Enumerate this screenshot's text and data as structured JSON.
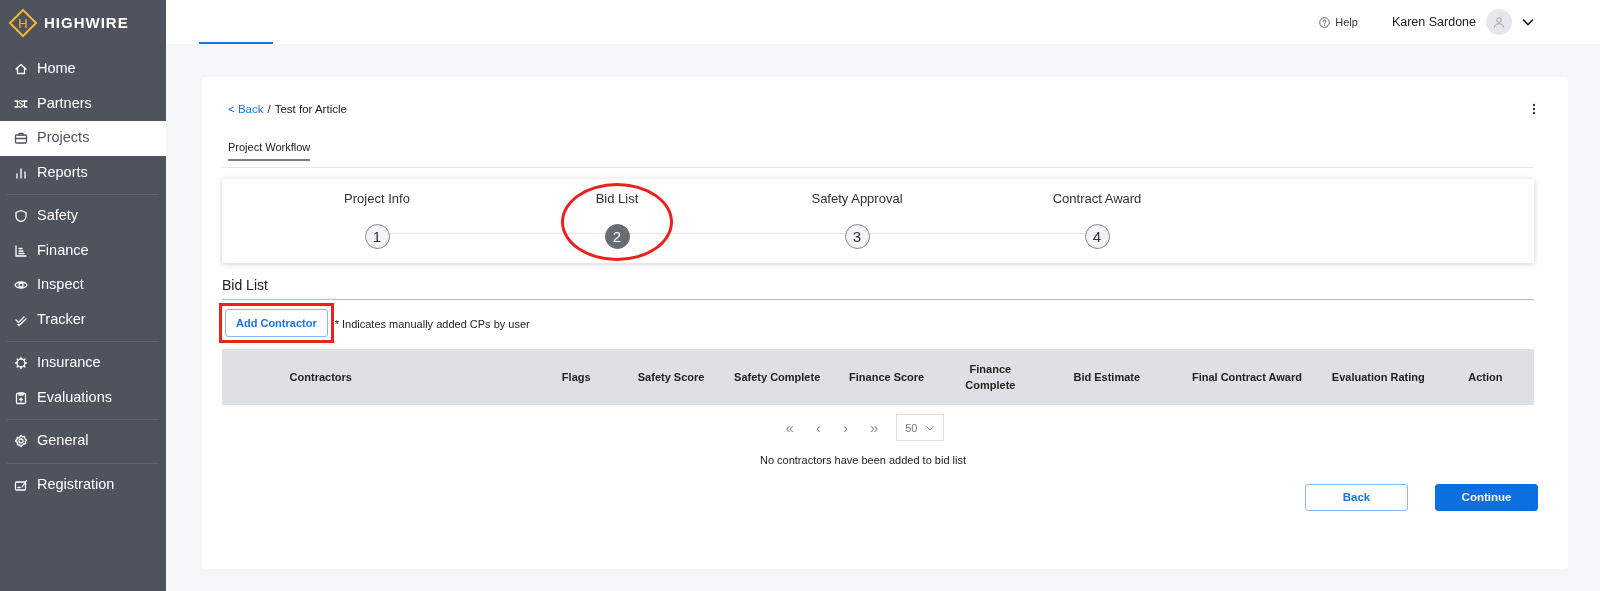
{
  "brand": {
    "name": "HIGHWIRE",
    "letter": "H"
  },
  "sidebar": {
    "groups": [
      {
        "items": [
          {
            "label": "Home",
            "selected": false
          },
          {
            "label": "Partners",
            "selected": false
          },
          {
            "label": "Projects",
            "selected": true
          },
          {
            "label": "Reports",
            "selected": false
          }
        ]
      },
      {
        "items": [
          {
            "label": "Safety",
            "selected": false
          },
          {
            "label": "Finance",
            "selected": false
          },
          {
            "label": "Inspect",
            "selected": false
          },
          {
            "label": "Tracker",
            "selected": false
          }
        ]
      },
      {
        "items": [
          {
            "label": "Insurance",
            "selected": false
          },
          {
            "label": "Evaluations",
            "selected": false
          }
        ]
      },
      {
        "items": [
          {
            "label": "General",
            "selected": false
          }
        ]
      },
      {
        "items": [
          {
            "label": "Registration",
            "selected": false
          }
        ]
      }
    ]
  },
  "topbar": {
    "help": "Help",
    "user": "Karen Sardone"
  },
  "breadcrumb": {
    "back": "< Back",
    "separator": "/",
    "current": "Test for Article"
  },
  "section_tab": "Project Workflow",
  "steps": [
    {
      "label": "Project Info",
      "number": "1",
      "selected": false,
      "circled": false
    },
    {
      "label": "Bid List",
      "number": "2",
      "selected": true,
      "circled": true
    },
    {
      "label": "Safety Approval",
      "number": "3",
      "selected": false,
      "circled": false
    },
    {
      "label": "Contract Award",
      "number": "4",
      "selected": false,
      "circled": false
    }
  ],
  "bid_list": {
    "title": "Bid List",
    "add_button": {
      "label": "Add Contractor",
      "boxed": true
    },
    "note": "* Indicates manually added CPs by user",
    "table": {
      "columns": [
        "Contractors",
        "Flags",
        "Safety Score",
        "Safety Complete",
        "Finance Score",
        "Finance Complete",
        "Bid Estimate",
        "Final Contract Award",
        "Evaluation Rating",
        "Action"
      ],
      "pagination": {
        "first": "«",
        "prev": "‹",
        "next": "›",
        "last": "»",
        "page_size": "50"
      },
      "empty_message": "No contractors have been added to bid list"
    }
  },
  "buttons": [
    {
      "label": "Back",
      "kind": "outline"
    },
    {
      "label": "Continue",
      "kind": "primary"
    }
  ]
}
